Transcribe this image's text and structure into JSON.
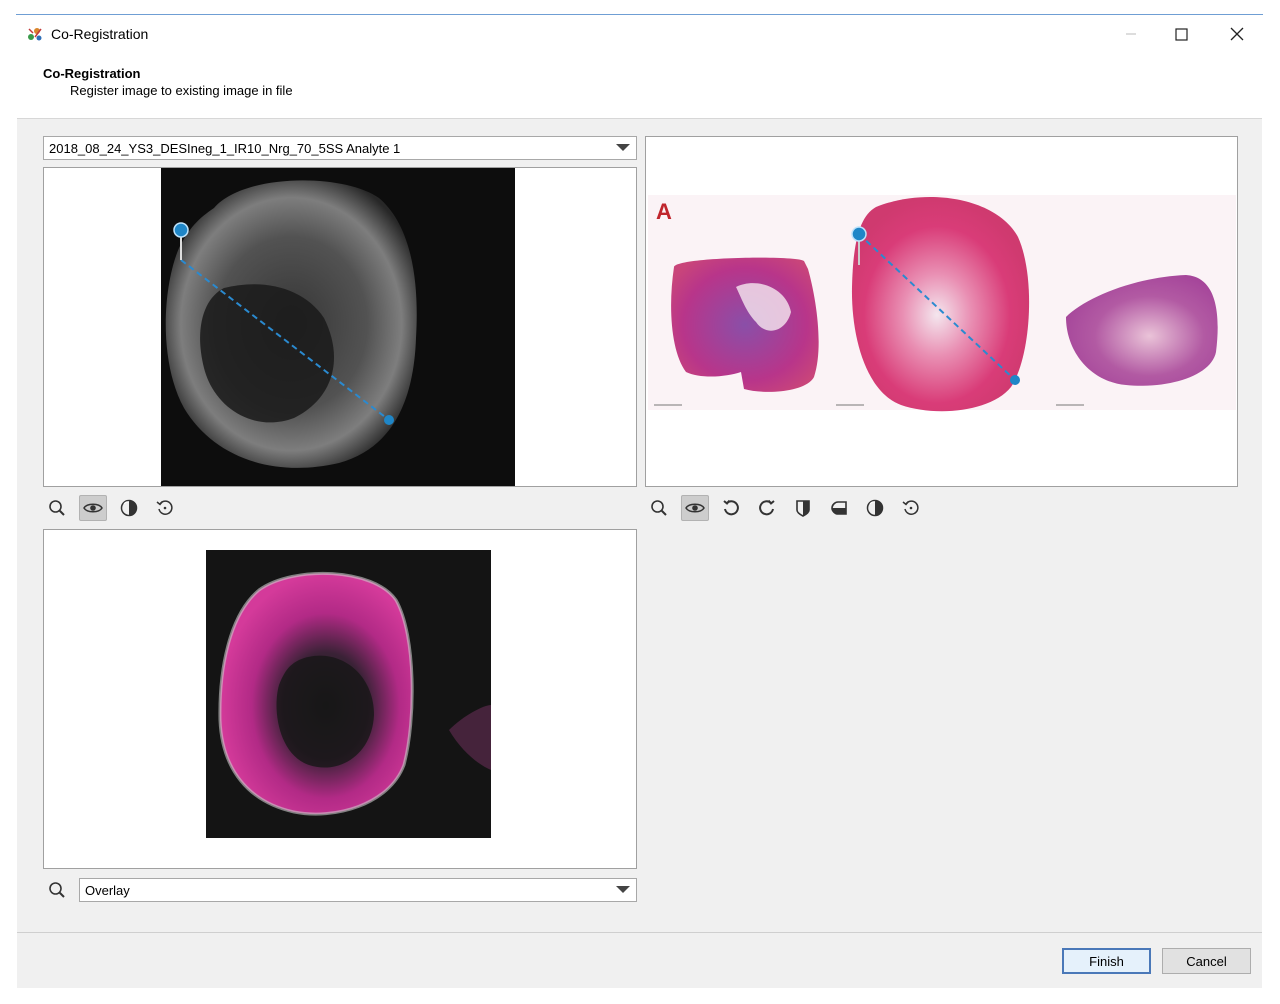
{
  "window": {
    "title": "Co-Registration",
    "minimize_icon": "minimize-icon",
    "maximize_icon": "maximize-icon",
    "close_icon": "close-icon"
  },
  "header": {
    "title": "Co-Registration",
    "subtitle": "Register image to existing image in file"
  },
  "left_pane": {
    "image_select_value": "2018_08_24_YS3_DESIneg_1_IR10_Nrg_70_5SS Analyte 1",
    "toolbar_icons": [
      "zoom-icon",
      "eye-icon",
      "contrast-icon",
      "reset-icon"
    ]
  },
  "right_pane": {
    "panel_label": "A",
    "toolbar_icons": [
      "zoom-icon",
      "eye-icon",
      "rotate-left-icon",
      "rotate-right-icon",
      "flip-vertical-icon",
      "flip-horizontal-icon",
      "contrast-icon",
      "reset-icon"
    ]
  },
  "overlay_pane": {
    "mode_value": "Overlay"
  },
  "buttons": {
    "finish": "Finish",
    "cancel": "Cancel"
  },
  "colors": {
    "accent": "#4a78b8",
    "marker": "#1f86c7"
  }
}
